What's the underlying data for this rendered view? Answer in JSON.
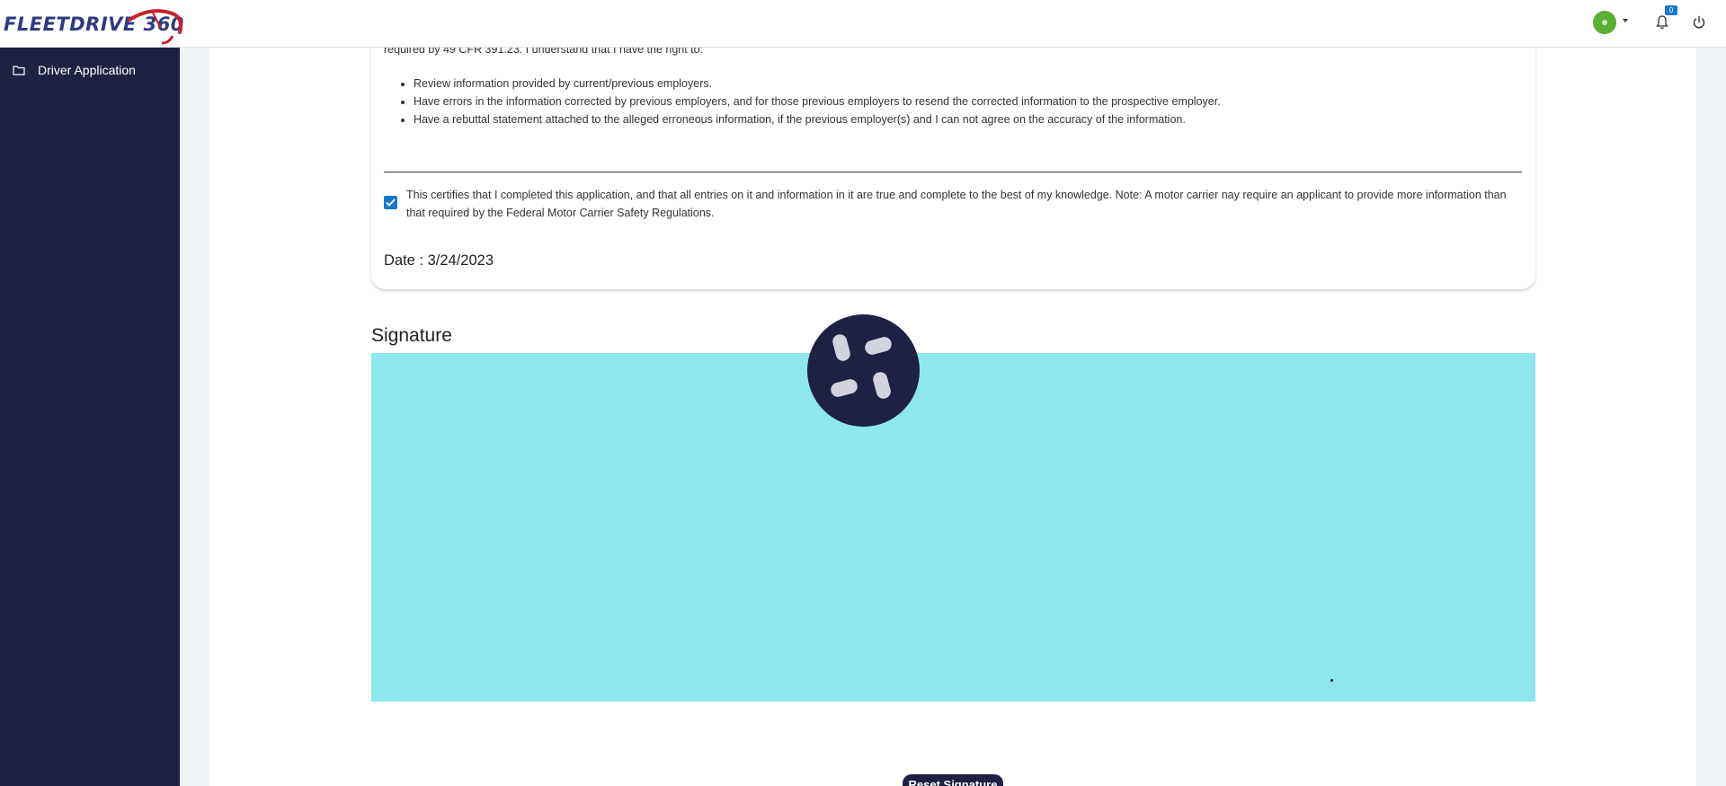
{
  "header": {
    "logo_text": "FLEETDRIVE",
    "logo_number": "360",
    "notification_count": "0",
    "icons": {
      "avatar": "user-avatar",
      "caret": "caret-down-icon",
      "bell": "bell-icon",
      "power": "power-icon"
    },
    "colors": {
      "brand": "#2f3b80",
      "avatar": "#5ab030",
      "badge": "#1976d2"
    }
  },
  "sidebar": {
    "background": "#1f2144",
    "items": [
      {
        "label": "Driver Application",
        "icon": "folder-icon"
      }
    ]
  },
  "content": {
    "clipped_text": "required by 49 CFR 391.23. I understand that I have the right to:",
    "rights": [
      "Review information provided by current/previous employers.",
      "Have errors in the information corrected by previous employers, and for those previous employers to resend the corrected information to the prospective employer.",
      "Have a rebuttal statement attached to the alleged erroneous information, if the previous employer(s) and I can not agree on the accuracy of the information."
    ],
    "certification": {
      "checked": true,
      "text": "This certifies that I completed this application, and that all entries on it and information in it are true and complete to the best of my knowledge. Note: A motor carrier nay require an applicant to provide more information than that required by the Federal Motor Carrier Safety Regulations."
    },
    "date_label": "Date : 3/24/2023"
  },
  "signature": {
    "title": "Signature",
    "pad_color": "#8ee6ee",
    "reset_button": "Reset Signature"
  },
  "loader": {
    "icon": "loading-spinner-icon"
  }
}
